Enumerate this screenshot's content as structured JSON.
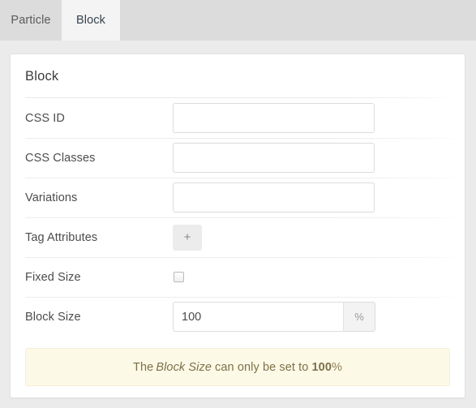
{
  "tabs": [
    {
      "id": "particle",
      "label": "Particle",
      "active": false
    },
    {
      "id": "block",
      "label": "Block",
      "active": true
    }
  ],
  "panel": {
    "title": "Block",
    "fields": [
      {
        "name": "css-id",
        "label": "CSS ID",
        "type": "text",
        "value": "",
        "placeholder": ""
      },
      {
        "name": "css-classes",
        "label": "CSS Classes",
        "type": "text",
        "value": "",
        "placeholder": ""
      },
      {
        "name": "variations",
        "label": "Variations",
        "type": "text",
        "value": "",
        "placeholder": ""
      },
      {
        "name": "tag-attributes",
        "label": "Tag Attributes",
        "type": "button",
        "button_label": "+"
      },
      {
        "name": "fixed-size",
        "label": "Fixed Size",
        "type": "checkbox",
        "checked": false
      },
      {
        "name": "block-size",
        "label": "Block Size",
        "type": "text-addon",
        "value": "100",
        "addon": "%"
      }
    ]
  },
  "notice": {
    "prefix": "The",
    "emphasis": "Block Size",
    "middle": "can only be set to",
    "strong": "100",
    "suffix": "%"
  },
  "colors": {
    "page_background": "#ebebeb",
    "tabbar_background": "#dcdcdc",
    "active_tab_background": "#f4f4f4",
    "panel_background": "#ffffff",
    "notice_background": "#fdf9e7",
    "notice_text": "#7d7048",
    "label_text": "#4c4c4c"
  }
}
